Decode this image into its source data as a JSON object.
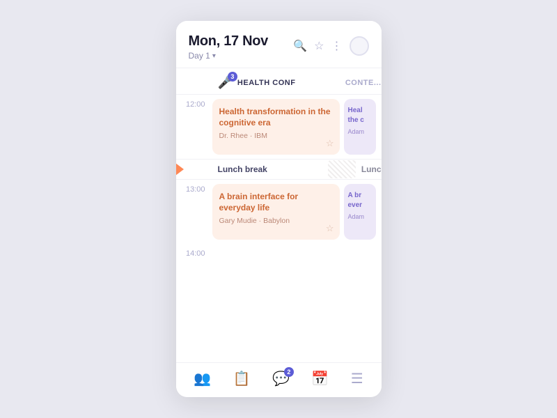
{
  "header": {
    "date": "Mon, 17 Nov",
    "day_label": "Day 1",
    "search_icon": "🔍",
    "star_icon": "☆",
    "more_icon": "⋮"
  },
  "tracks": {
    "track1_icon": "🎤",
    "track1_badge": "3",
    "track1_name": "HEALTH CONF",
    "track2_name": "CONTE..."
  },
  "sessions_12": [
    {
      "title": "Health transformation in the cognitive era",
      "speaker": "Dr. Rhee · IBM",
      "type": "peach"
    },
    {
      "title": "Heal the c",
      "speaker": "Adam",
      "type": "lavender"
    }
  ],
  "lunch": {
    "label": "Lunch break",
    "label_right": "Lunc"
  },
  "sessions_13": [
    {
      "title": "A brain interface for everyday life",
      "speaker": "Gary Mudie · Babylon",
      "type": "peach"
    },
    {
      "title": "A br ever",
      "speaker": "Adam",
      "type": "lavender"
    }
  ],
  "times": {
    "t12": "12:00",
    "t13": "13:00",
    "t14": "14:00"
  },
  "nav": {
    "items": [
      {
        "icon": "👥",
        "label": "people",
        "badge": null,
        "active": false
      },
      {
        "icon": "📋",
        "label": "schedule",
        "badge": null,
        "active": false
      },
      {
        "icon": "💬",
        "label": "messages",
        "badge": "2",
        "active": false
      },
      {
        "icon": "📅",
        "label": "calendar",
        "badge": null,
        "active": true
      },
      {
        "icon": "☰",
        "label": "menu",
        "badge": null,
        "active": false
      }
    ]
  }
}
